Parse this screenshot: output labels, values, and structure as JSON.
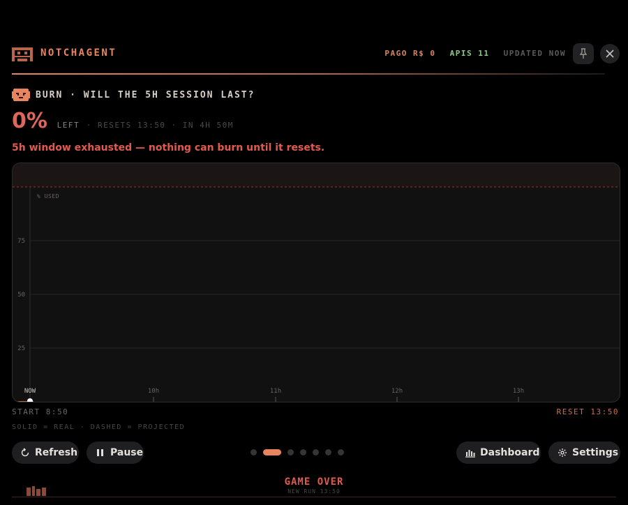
{
  "header": {
    "app_title": "NOTCHAGENT",
    "pago": "PAGO R$ 0",
    "apis": "APIS 11",
    "updated": "UPDATED NOW",
    "icons": {
      "logo": "pixel-invader-icon",
      "pin": "pin-icon",
      "close": "close-icon"
    }
  },
  "burn": {
    "title": "BURN · WILL THE 5H SESSION LAST?",
    "percent": "0%",
    "left_label": "LEFT",
    "meta": "· RESETS 13:50 · IN 4H 50M",
    "warning": "5h window exhausted — nothing can burn until it resets."
  },
  "chart_data": {
    "type": "line",
    "ylabel": "% USED",
    "ylim": [
      0,
      100
    ],
    "yticks": [
      25,
      50,
      75
    ],
    "xticks": [
      "NOW",
      "10h",
      "11h",
      "12h",
      "13h"
    ],
    "series": [],
    "limit_line": {
      "value": 100,
      "style": "dashed",
      "color": "#8a3a2e"
    },
    "grid": true
  },
  "axis": {
    "start": "START 8:50",
    "reset": "RESET 13:50"
  },
  "legend": "SOLID = REAL · DASHED = PROJECTED",
  "controls": {
    "refresh": "Refresh",
    "pause": "Pause",
    "dashboard": "Dashboard",
    "settings": "Settings",
    "pager_total": 7,
    "pager_active": 2
  },
  "footer": {
    "game_over": "GAME OVER",
    "new_run": "NEW RUN 13:50"
  },
  "colors": {
    "accent": "#e8845e",
    "danger": "#e05a4e",
    "ok": "#8fc98a",
    "background": "#000000"
  }
}
